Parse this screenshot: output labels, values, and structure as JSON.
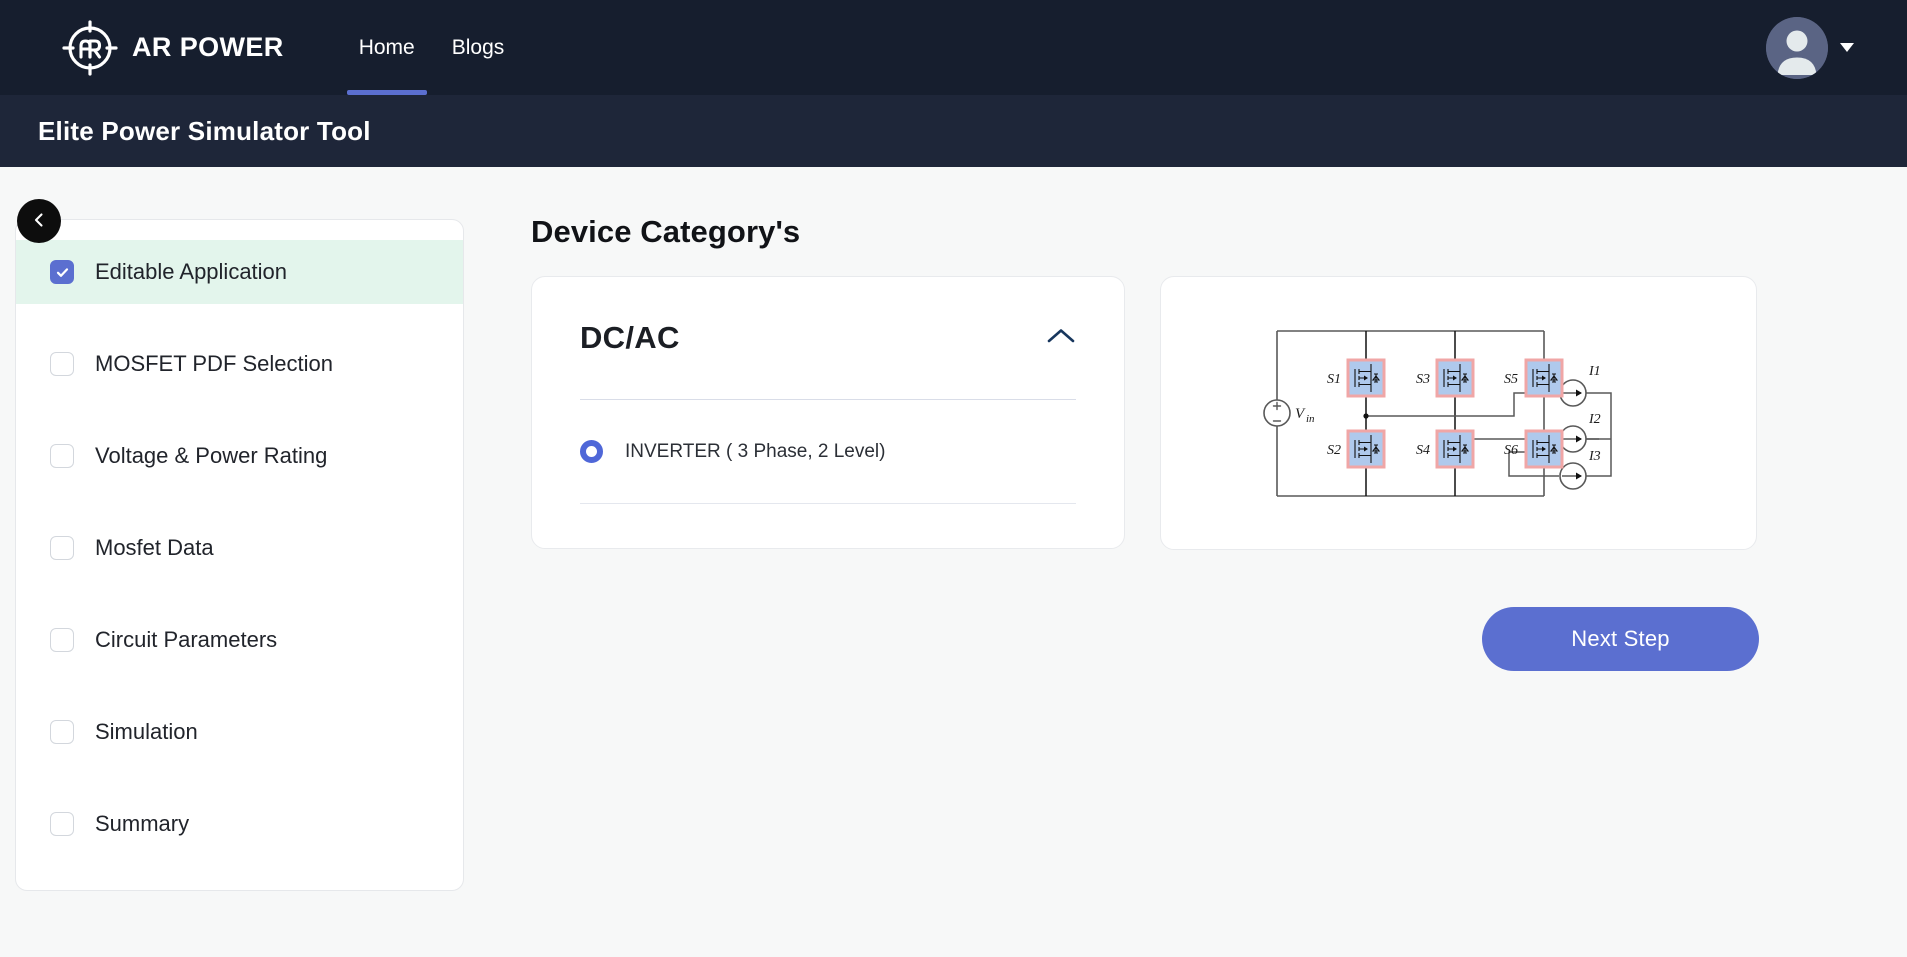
{
  "header": {
    "brand_name": "AR POWER",
    "logo_icon": "ar-power-logo-icon",
    "nav": [
      {
        "label": "Home",
        "active": true
      },
      {
        "label": "Blogs",
        "active": false
      }
    ],
    "profile": {
      "avatar_icon": "user-avatar-icon",
      "caret_icon": "chevron-down-icon"
    },
    "accent_color": "#5B6FD0",
    "nav_bg": "#161E2E"
  },
  "subheader": {
    "title": "Elite Power Simulator Tool",
    "bg": "#1E2639"
  },
  "sidebar": {
    "collapse_icon": "chevron-left-icon",
    "selected_bg": "#E3F5EC",
    "items": [
      {
        "label": "Editable Application",
        "checked": true
      },
      {
        "label": "MOSFET PDF Selection",
        "checked": false
      },
      {
        "label": "Voltage & Power Rating",
        "checked": false
      },
      {
        "label": "Mosfet Data",
        "checked": false
      },
      {
        "label": "Circuit Parameters",
        "checked": false
      },
      {
        "label": "Simulation",
        "checked": false
      },
      {
        "label": "Summary",
        "checked": false
      }
    ]
  },
  "main": {
    "page_title": "Device Category's",
    "category_card": {
      "title": "DC/AC",
      "toggle_icon": "chevron-up-icon",
      "expanded": true,
      "options": [
        {
          "label": "INVERTER ( 3 Phase, 2 Level)",
          "selected": true
        }
      ]
    },
    "diagram": {
      "name": "three-phase-two-level-inverter-schematic",
      "source_label": "Vin",
      "switches": [
        "S1",
        "S3",
        "S5",
        "S2",
        "S4",
        "S6"
      ],
      "outputs": [
        "I1",
        "I2",
        "I3"
      ],
      "switch_fill": "#AFC9EC",
      "switch_border": "#F0A6A6"
    },
    "next_button": "Next Step"
  }
}
